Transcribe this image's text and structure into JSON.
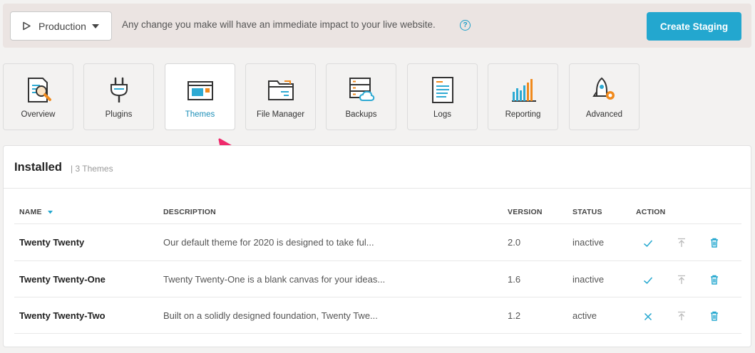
{
  "banner": {
    "environment": "Production",
    "message": "Any change you make will have an immediate impact to your live website.",
    "help_glyph": "?",
    "create_button": "Create Staging",
    "accent_color": "#23a7cf"
  },
  "tools": [
    {
      "label": "Overview",
      "icon": "overview-icon"
    },
    {
      "label": "Plugins",
      "icon": "plugin-icon"
    },
    {
      "label": "Themes",
      "icon": "themes-icon",
      "active": true
    },
    {
      "label": "File Manager",
      "icon": "folder-icon"
    },
    {
      "label": "Backups",
      "icon": "backups-icon"
    },
    {
      "label": "Logs",
      "icon": "logs-icon"
    },
    {
      "label": "Reporting",
      "icon": "reporting-icon"
    },
    {
      "label": "Advanced",
      "icon": "advanced-icon"
    }
  ],
  "installed": {
    "title": "Installed",
    "count": "| 3 Themes",
    "columns": [
      "NAME",
      "DESCRIPTION",
      "VERSION",
      "STATUS",
      "ACTION"
    ],
    "rows": [
      {
        "name": "Twenty Twenty",
        "description": "Our default theme for 2020 is designed to take ful...",
        "version": "2.0",
        "status": "inactive",
        "primary_action": "activate-check-icon"
      },
      {
        "name": "Twenty Twenty-One",
        "description": "Twenty Twenty-One is a blank canvas for your ideas...",
        "version": "1.6",
        "status": "inactive",
        "primary_action": "activate-check-icon"
      },
      {
        "name": "Twenty Twenty-Two",
        "description": "Built on a solidly designed foundation, Twenty Twe...",
        "version": "1.2",
        "status": "active",
        "primary_action": "deactivate-x-icon"
      }
    ]
  }
}
